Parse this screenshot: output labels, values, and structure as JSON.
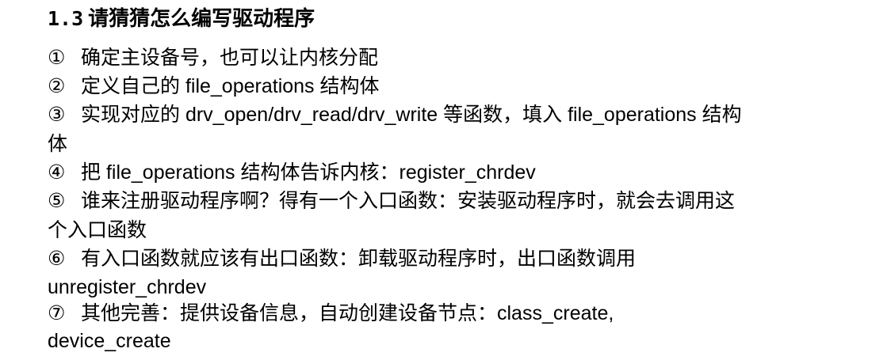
{
  "heading": {
    "number": "1.3",
    "title": "请猜猜怎么编写驱动程序"
  },
  "steps": [
    {
      "marker": "①",
      "lines": [
        "确定主设备号，也可以让内核分配"
      ]
    },
    {
      "marker": "②",
      "lines": [
        "定义自己的 file_operations 结构体"
      ]
    },
    {
      "marker": "③",
      "lines": [
        "实现对应的 drv_open/drv_read/drv_write 等函数，填入 file_operations 结构",
        "体"
      ]
    },
    {
      "marker": "④",
      "lines": [
        "把 file_operations 结构体告诉内核：register_chrdev"
      ]
    },
    {
      "marker": "⑤",
      "lines": [
        "谁来注册驱动程序啊？得有一个入口函数：安装驱动程序时，就会去调用这",
        "个入口函数"
      ]
    },
    {
      "marker": "⑥",
      "lines": [
        "有入口函数就应该有出口函数：卸载驱动程序时，出口函数调用",
        "unregister_chrdev"
      ]
    },
    {
      "marker": "⑦",
      "lines": [
        "其他完善：提供设备信息，自动创建设备节点：class_create,",
        "device_create"
      ]
    }
  ]
}
